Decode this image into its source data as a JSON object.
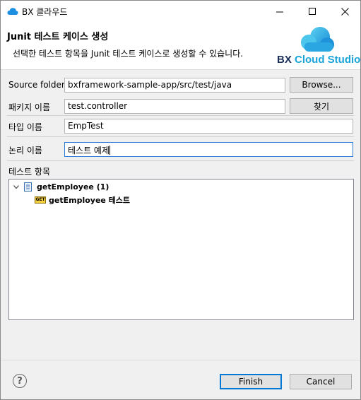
{
  "window": {
    "title": "BX 클라우드"
  },
  "banner": {
    "title": "Junit 테스트 케이스 생성",
    "description": "선택한 테스트 항목을 Junit 테스트 케이스로 생성할 수 있습니다.",
    "logo_bx": "BX",
    "logo_cloud_studio": "Cloud Studio"
  },
  "form": {
    "source_folder": {
      "label": "Source folder:",
      "value": "bxframework-sample-app/src/test/java",
      "button": "Browse..."
    },
    "package": {
      "label": "패키지 이름",
      "value": "test.controller",
      "button": "찾기"
    },
    "type": {
      "label": "타입 이름",
      "value": "EmpTest"
    },
    "logical": {
      "label": "논리 이름",
      "value": "테스트 예제"
    }
  },
  "tests": {
    "label": "테스트 항목",
    "root": "getEmployee (1)",
    "child": "getEmployee 테스트",
    "method_badge": "GET"
  },
  "footer": {
    "finish": "Finish",
    "cancel": "Cancel",
    "help": "?"
  },
  "colors": {
    "accent": "#0078d7",
    "logo_dark": "#1c2f5a",
    "logo_light": "#1aa3d9",
    "badge": "#f4d03f"
  }
}
